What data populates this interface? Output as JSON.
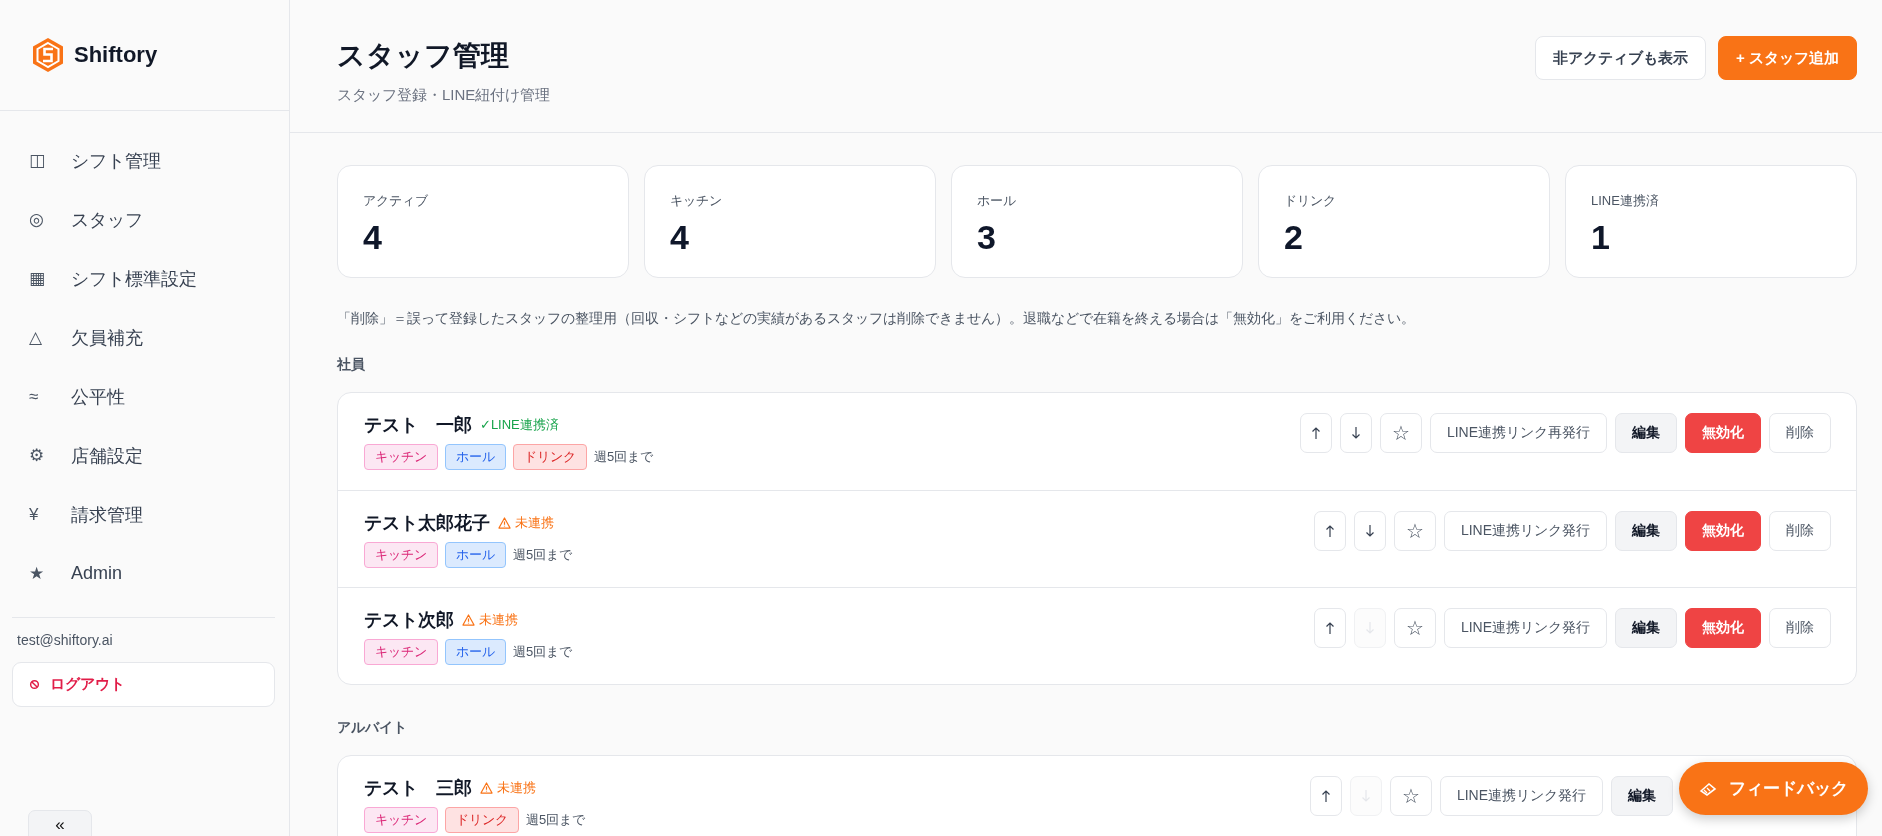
{
  "sidebar": {
    "brand": "Shiftory",
    "items": [
      {
        "icon": "◫",
        "label": "シフト管理"
      },
      {
        "icon": "◎",
        "label": "スタッフ"
      },
      {
        "icon": "▦",
        "label": "シフト標準設定"
      },
      {
        "icon": "△",
        "label": "欠員補充"
      },
      {
        "icon": "≈",
        "label": "公平性"
      },
      {
        "icon": "⚙",
        "label": "店舗設定"
      },
      {
        "icon": "¥",
        "label": "請求管理"
      },
      {
        "icon": "★",
        "label": "Admin"
      }
    ],
    "email": "test@shiftory.ai",
    "logout": "ログアウト",
    "collapse": "«"
  },
  "header": {
    "title": "スタッフ管理",
    "subtitle": "スタッフ登録・LINE紐付け管理",
    "buttons": [
      {
        "kind": "outline",
        "label": "非アクティブも表示"
      },
      {
        "kind": "primary",
        "label": "+ スタッフ追加"
      }
    ]
  },
  "stats": [
    {
      "label": "アクティブ",
      "value": "4"
    },
    {
      "label": "キッチン",
      "value": "4"
    },
    {
      "label": "ホール",
      "value": "3"
    },
    {
      "label": "ドリンク",
      "value": "2"
    },
    {
      "label": "LINE連携済",
      "value": "1"
    }
  ],
  "note": "「削除」＝誤って登録したスタッフの整理用（回収・シフトなどの実績があるスタッフは削除できません）。退職などで在籍を終える場合は「無効化」をご利用ください。",
  "groups": [
    {
      "title": "社員",
      "staff": [
        {
          "name": "テスト　一郎",
          "line": {
            "kind": "linked",
            "label": "✓LINE連携済"
          },
          "tags": [
            {
              "kind": "kitchen",
              "label": "キッチン"
            },
            {
              "kind": "hall",
              "label": "ホール"
            },
            {
              "kind": "drink",
              "label": "ドリンク"
            }
          ],
          "limit": "週5回まで",
          "up_disabled": false,
          "down_disabled": false,
          "star": "☆",
          "link_button": "LINE連携リンク再発行",
          "actions": [
            {
              "kind": "edit",
              "label": "編集"
            },
            {
              "kind": "danger",
              "label": "無効化"
            },
            {
              "kind": "outline",
              "label": "削除"
            }
          ]
        },
        {
          "name": "テスト太郎花子",
          "line": {
            "kind": "unlinked",
            "label": "未連携"
          },
          "tags": [
            {
              "kind": "kitchen",
              "label": "キッチン"
            },
            {
              "kind": "hall",
              "label": "ホール"
            }
          ],
          "limit": "週5回まで",
          "up_disabled": false,
          "down_disabled": false,
          "star": "☆",
          "link_button": "LINE連携リンク発行",
          "actions": [
            {
              "kind": "edit",
              "label": "編集"
            },
            {
              "kind": "danger",
              "label": "無効化"
            },
            {
              "kind": "outline",
              "label": "削除"
            }
          ]
        },
        {
          "name": "テスト次郎",
          "line": {
            "kind": "unlinked",
            "label": "未連携"
          },
          "tags": [
            {
              "kind": "kitchen",
              "label": "キッチン"
            },
            {
              "kind": "hall",
              "label": "ホール"
            }
          ],
          "limit": "週5回まで",
          "up_disabled": false,
          "down_disabled": true,
          "star": "☆",
          "link_button": "LINE連携リンク発行",
          "actions": [
            {
              "kind": "edit",
              "label": "編集"
            },
            {
              "kind": "danger",
              "label": "無効化"
            },
            {
              "kind": "outline",
              "label": "削除"
            }
          ]
        }
      ]
    },
    {
      "title": "アルバイト",
      "staff": [
        {
          "name": "テスト　三郎",
          "line": {
            "kind": "unlinked",
            "label": "未連携"
          },
          "tags": [
            {
              "kind": "kitchen",
              "label": "キッチン"
            },
            {
              "kind": "drink",
              "label": "ドリンク"
            }
          ],
          "limit": "週5回まで",
          "up_disabled": false,
          "down_disabled": true,
          "star": "☆",
          "link_button": "LINE連携リンク発行",
          "actions": [
            {
              "kind": "edit",
              "label": "編集"
            }
          ]
        }
      ]
    }
  ],
  "feedback": "フィードバック"
}
